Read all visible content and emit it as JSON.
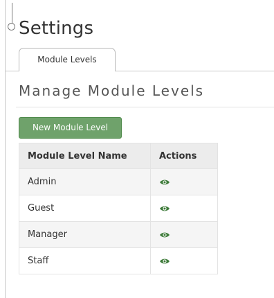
{
  "page": {
    "title": "Settings"
  },
  "tabs": [
    {
      "label": "Module Levels",
      "active": true
    }
  ],
  "section": {
    "title": "Manage Module Levels"
  },
  "actions": {
    "new_button_label": "New Module Level"
  },
  "table": {
    "columns": [
      "Module Level Name",
      "Actions"
    ],
    "rows": [
      {
        "name": "Admin",
        "action_icon": "view-eye-icon"
      },
      {
        "name": "Guest",
        "action_icon": "view-eye-icon"
      },
      {
        "name": "Manager",
        "action_icon": "view-eye-icon"
      },
      {
        "name": "Staff",
        "action_icon": "view-eye-icon"
      }
    ]
  },
  "colors": {
    "button_green": "#6fa26b",
    "icon_green": "#3e7b3a"
  }
}
